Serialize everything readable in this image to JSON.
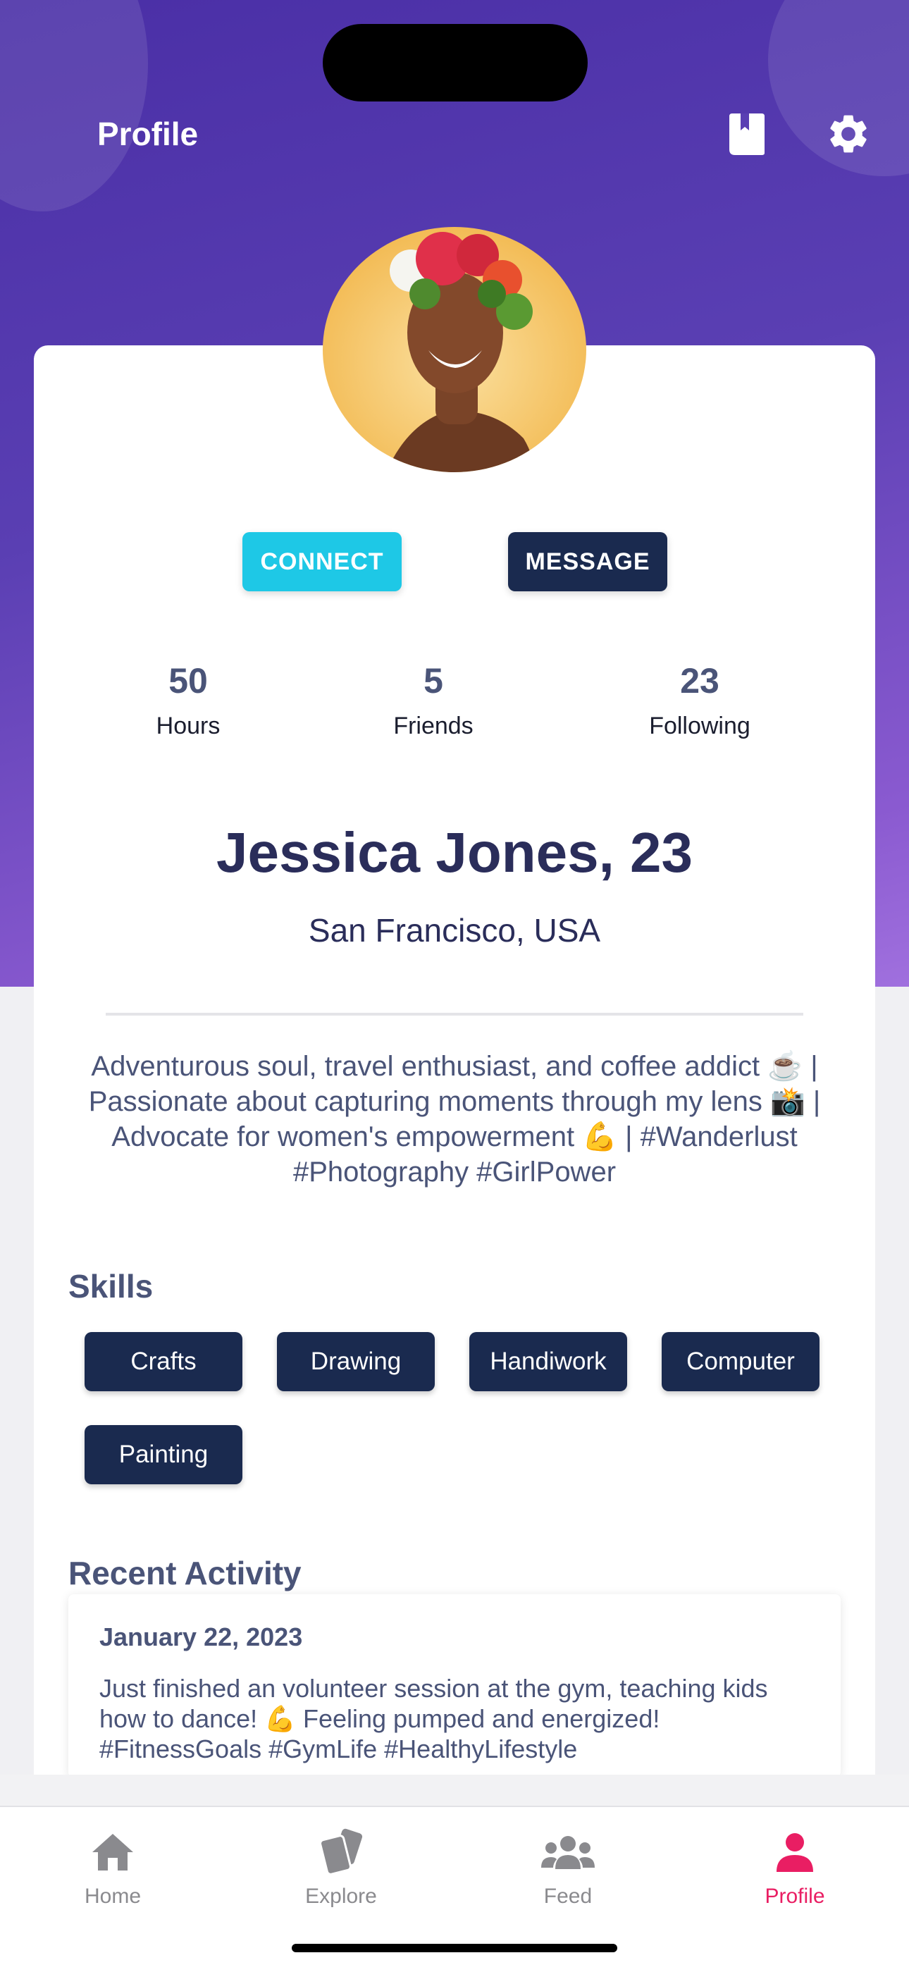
{
  "header": {
    "title": "Profile",
    "bookmark_icon": "bookmark-icon",
    "settings_icon": "gear-icon"
  },
  "actions": {
    "connect_label": "CONNECT",
    "message_label": "MESSAGE"
  },
  "stats": [
    {
      "value": "50",
      "label": "Hours"
    },
    {
      "value": "5",
      "label": "Friends"
    },
    {
      "value": "23",
      "label": "Following"
    }
  ],
  "profile": {
    "name": "Jessica Jones, 23",
    "location": "San Francisco, USA",
    "bio": "Adventurous soul, travel enthusiast, and coffee addict ☕ | Passionate about capturing moments through my lens 📸 | Advocate for women's empowerment 💪 | #Wanderlust #Photography #GirlPower"
  },
  "skills": {
    "title": "Skills",
    "items": [
      "Crafts",
      "Drawing",
      "Handiwork",
      "Computer",
      "Painting"
    ]
  },
  "recent_activity": {
    "title": "Recent Activity",
    "items": [
      {
        "date": "January 22, 2023",
        "text": "Just finished an volunteer session at the gym, teaching kids how to dance! 💪 Feeling pumped and energized! #FitnessGoals #GymLife #HealthyLifestyle"
      }
    ]
  },
  "tabbar": {
    "items": [
      {
        "label": "Home",
        "icon": "home-icon"
      },
      {
        "label": "Explore",
        "icon": "cards-icon"
      },
      {
        "label": "Feed",
        "icon": "people-icon"
      },
      {
        "label": "Profile",
        "icon": "person-icon"
      }
    ],
    "active": "Profile",
    "active_color": "#e91e63"
  },
  "colors": {
    "connect": "#1ec8e6",
    "message": "#1a2a4f",
    "chip": "#1a2a4f"
  }
}
